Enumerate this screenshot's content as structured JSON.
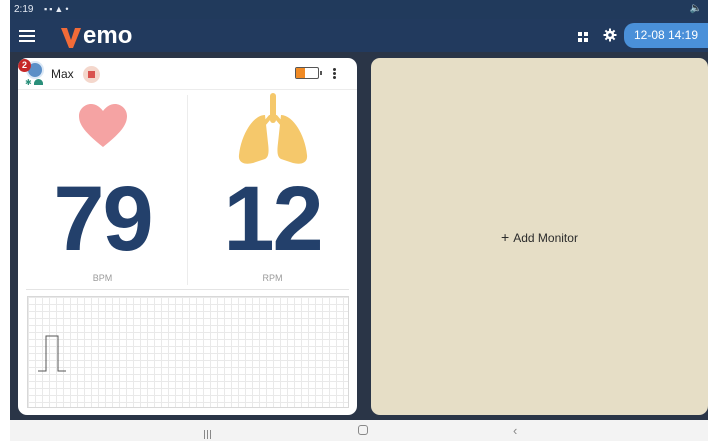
{
  "status_bar": {
    "time": "2:19",
    "icons": [
      "gallery-icon",
      "image-icon",
      "alert-icon",
      "dot-icon"
    ],
    "right_icon": "mute-icon"
  },
  "app": {
    "logo_initial": "V",
    "logo_rest": "emo",
    "datetime": "12-08 14:19",
    "colors": {
      "appbar": "#223a5e",
      "datetime_bg": "#4a90d9",
      "logo_v": "#f26b38",
      "workarea": "#2a3547",
      "add_panel": "#e6dec6",
      "vital_value": "#23406b",
      "heart": "#f5a3a3",
      "lungs": "#f5c86b"
    }
  },
  "monitor": {
    "badge": "2",
    "patient_name": "Max",
    "battery_level": 0.4,
    "heart_rate": {
      "value": "79",
      "unit": "BPM",
      "icon": "heart-icon"
    },
    "respiration": {
      "value": "12",
      "unit": "RPM",
      "icon": "lungs-icon"
    },
    "waveform": "ecg-waveform"
  },
  "add_monitor": {
    "plus": "+",
    "label": "Add Monitor"
  }
}
